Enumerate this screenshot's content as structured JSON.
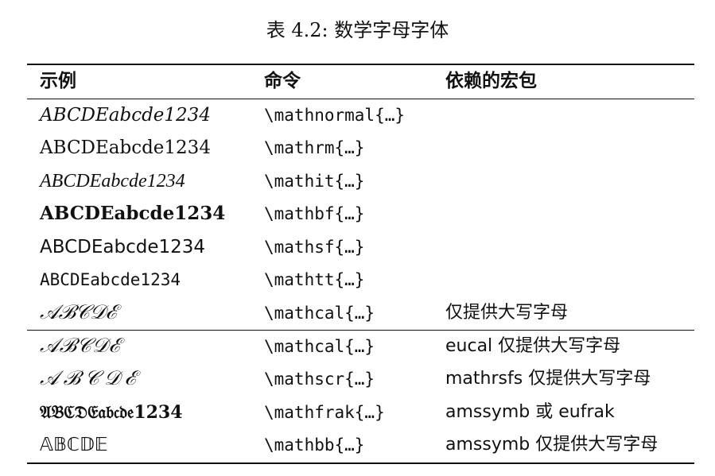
{
  "caption": "表 4.2: 数学字母字体",
  "headers": [
    "示例",
    "命令",
    "依赖的宏包"
  ],
  "rows": [
    {
      "example": "ABCDEabcde1234",
      "command": "\\mathnormal{…}",
      "package": ""
    },
    {
      "example": "ABCDEabcde1234",
      "command": "\\mathrm{…}",
      "package": ""
    },
    {
      "example": "ABCDEabcde1234",
      "command": "\\mathit{…}",
      "package": ""
    },
    {
      "example": "ABCDEabcde1234",
      "command": "\\mathbf{…}",
      "package": ""
    },
    {
      "example": "ABCDEabcde1234",
      "command": "\\mathsf{…}",
      "package": ""
    },
    {
      "example": "ABCDEabcde1234",
      "command": "\\mathtt{…}",
      "package": ""
    },
    {
      "example": "𝒜ℬ𝒞𝒟ℰ",
      "command": "\\mathcal{…}",
      "package": "仅提供大写字母"
    },
    {
      "example": "𝒜ℬ𝒞𝒟ℰ",
      "command": "\\mathcal{…}",
      "package": "eucal 仅提供大写字母"
    },
    {
      "example": "𝒜ℬ𝒞𝒟ℰ",
      "command": "\\mathscr{…}",
      "package": "mathrsfs 仅提供大写字母"
    },
    {
      "example": "𝔄𝔅ℭ𝔇𝔈𝔞𝔟𝔠𝔡𝔢1234",
      "command": "\\mathfrak{…}",
      "package": "amssymb 或 eufrak"
    },
    {
      "example": "𝔸𝔹ℂ𝔻𝔼",
      "command": "\\mathbb{…}",
      "package": "amssymb 仅提供大写字母"
    }
  ]
}
